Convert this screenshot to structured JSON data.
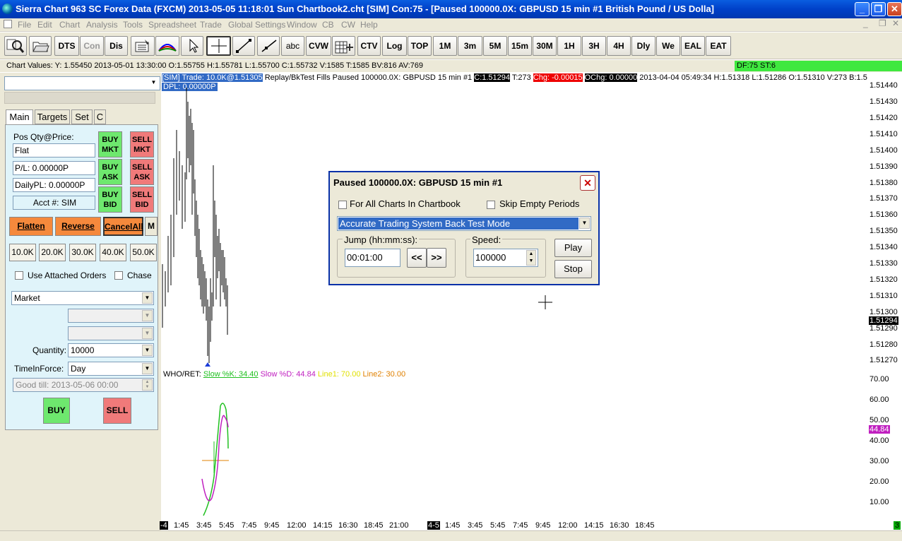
{
  "window": {
    "title": "Sierra Chart 963 SC Forex Data (FXCM) 2013-05-05  11:18:01 Sun  Chartbook2.cht [SIM] Con:75 - [Paused 100000.0X: GBPUSD  15 min   #1  British Pound / US Dolla]"
  },
  "menu": [
    "File",
    "Edit",
    "Chart",
    "Analysis",
    "Tools",
    "Spreadsheet",
    "Trade",
    "Global Settings",
    "Window",
    "CB",
    "CW",
    "Help"
  ],
  "toolbar": {
    "buttons": [
      "DTS",
      "Con",
      "Dis",
      "CVW",
      "CTV",
      "Log",
      "TOP",
      "1M",
      "3m",
      "5M",
      "15m",
      "30M",
      "1H",
      "3H",
      "4H",
      "Dly",
      "We",
      "EAL",
      "EAT"
    ],
    "abc": "abc"
  },
  "values_bar": "Chart Values: Y: 1.55450  2013-05-01  13:30:00  O:1.55755  H:1.55781  L:1.55700  C:1.55732  V:1585  T:1585  BV:816  AV:769",
  "df_box": "DF:75  ST:6",
  "trade_panel": {
    "tabs": [
      "Main",
      "Targets",
      "Set",
      "C"
    ],
    "pos_label": "Pos Qty@Price:",
    "pos_value": "Flat",
    "pl": "P/L: 0.00000P",
    "daily_pl": "DailyPL: 0.00000P",
    "account": "Acct #: SIM",
    "buy_mkt": "BUY MKT",
    "sell_mkt": "SELL MKT",
    "buy_ask": "BUY ASK",
    "sell_ask": "SELL ASK",
    "buy_bid": "BUY BID",
    "sell_bid": "SELL BID",
    "flatten": "Flatten",
    "reverse": "Reverse",
    "cancel_all": "CancelAll",
    "m": "M",
    "quantities": [
      "10.0K",
      "20.0K",
      "30.0K",
      "40.0K",
      "50.0K"
    ],
    "use_attached": "Use Attached Orders",
    "chase": "Chase",
    "order_type": "Market",
    "quantity_label": "Quantity:",
    "quantity_value": "10000",
    "tif_label": "TimeInForce:",
    "tif_value": "Day",
    "good_till": "Good till: 2013-05-06 00:00",
    "buy": "BUY",
    "sell": "SELL"
  },
  "chart": {
    "header": {
      "sim": "[SIM]  Trade: 10.0K@1.51305",
      "replay": " Replay/BkTest Fills  Paused 100000.0X: GBPUSD  15 min   #1 ",
      "close": "C:1.51294",
      "ticks": " T:273 ",
      "chg": "Chg: -0.00015",
      "ochg": "OChg: 0.00000",
      "rest": " 2013-04-04 05:49:34 H:1.51318 L:1.51286 O:1.51310 V:273 B:1.5",
      "dpl": "DPL: 0.00000P"
    },
    "price_ticks": [
      "1.51440",
      "1.51430",
      "1.51420",
      "1.51410",
      "1.51400",
      "1.51390",
      "1.51380",
      "1.51370",
      "1.51360",
      "1.51350",
      "1.51340",
      "1.51330",
      "1.51320",
      "1.51310",
      "1.51300",
      "1.51290",
      "1.51280",
      "1.51270"
    ],
    "last_price": "1.51294",
    "stoch_label": {
      "name": "WHO/RET:",
      "k": "Slow %K: 34.40",
      "d": "Slow %D: 44.84",
      "line1": "Line1: 70.00",
      "line2": "Line2: 30.00"
    },
    "stoch_ticks": [
      "70.00",
      "60.00",
      "50.00",
      "40.00",
      "30.00",
      "20.00",
      "10.00"
    ],
    "stoch_last": "44.84",
    "time_ticks_1": [
      "1:45",
      "3:45",
      "5:45",
      "7:45",
      "9:45",
      "12:00",
      "14:15",
      "16:30",
      "18:45",
      "21:00"
    ],
    "time_ticks_2": [
      "1:45",
      "3:45",
      "5:45",
      "7:45",
      "9:45",
      "12:00",
      "14:15",
      "16:30",
      "18:45"
    ],
    "date_marker_1": "-4",
    "date_marker_2": "4-5",
    "corner_marker": "3"
  },
  "dialog": {
    "title": "Paused 100000.0X: GBPUSD  15 min   #1",
    "for_all": "For All Charts In Chartbook",
    "skip_empty": "Skip Empty Periods",
    "mode": "Accurate Trading System Back Test Mode",
    "jump_label": "Jump (hh:mm:ss):",
    "jump_value": "00:01:00",
    "back": "<<",
    "fwd": ">>",
    "speed_label": "Speed:",
    "speed_value": "100000",
    "play": "Play",
    "stop": "Stop"
  },
  "colors": {
    "title_bar": "#0040c8",
    "buy": "#6ee86e",
    "sell": "#f07a7a",
    "orange": "#f5893c",
    "panel_bg": "#e0f4fa",
    "selection": "#316ac5",
    "slow_k": "#20c020",
    "slow_d": "#c020c0",
    "line1": "#e0e000",
    "line2": "#e08000"
  }
}
